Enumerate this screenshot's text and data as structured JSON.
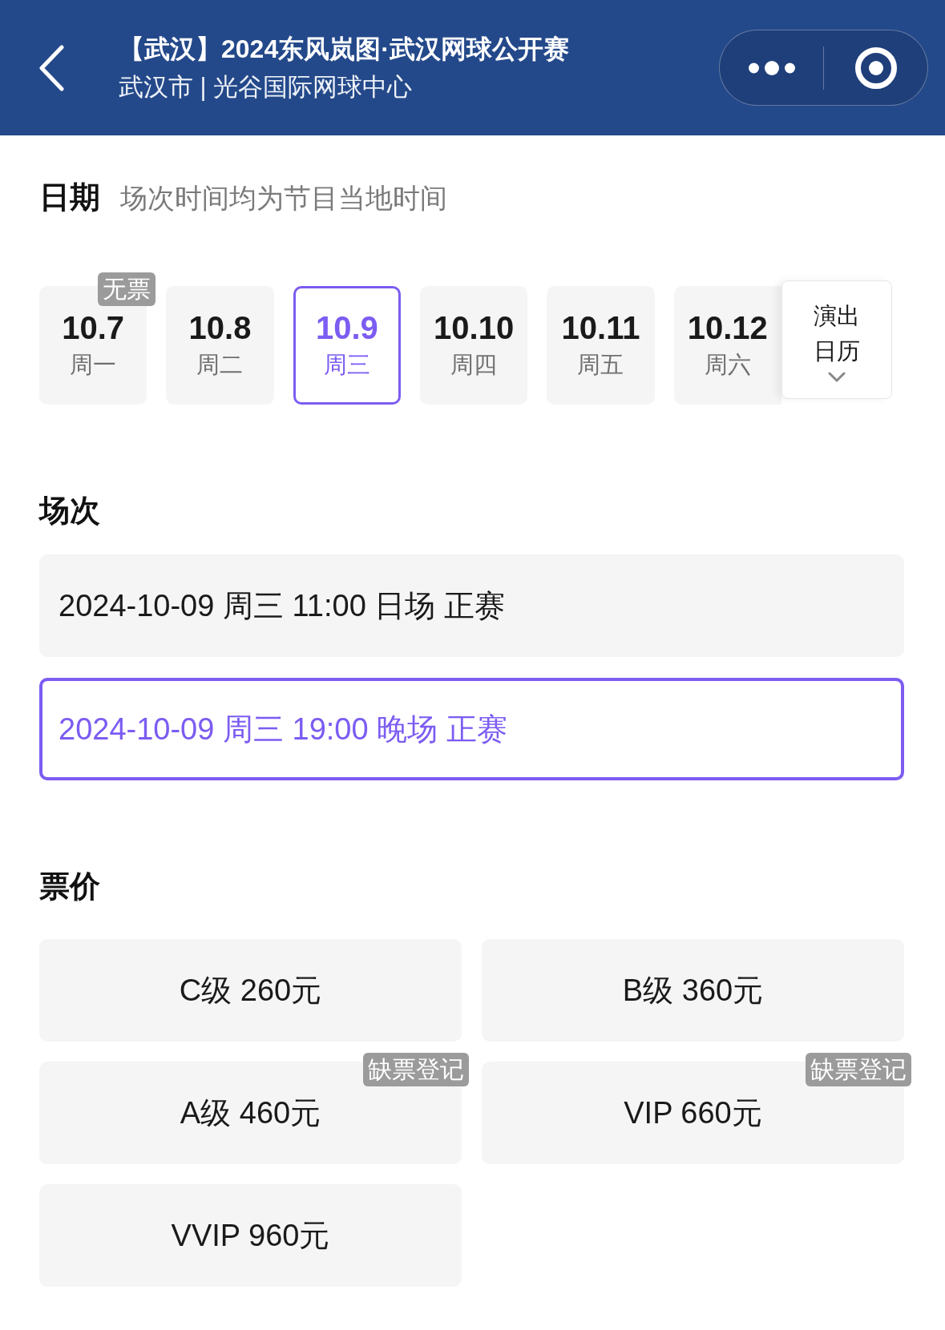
{
  "nav_bar": {
    "title": "【武汉】2024东风岚图·武汉网球公开赛",
    "subtitle": "武汉市 | 光谷国际网球中心"
  },
  "date_section": {
    "heading": "日期",
    "note": "场次时间均为节目当地时间",
    "dates": [
      {
        "date": "10.7",
        "weekday": "周一",
        "selected": false,
        "badge": "无票"
      },
      {
        "date": "10.8",
        "weekday": "周二",
        "selected": false
      },
      {
        "date": "10.9",
        "weekday": "周三",
        "selected": true
      },
      {
        "date": "10.10",
        "weekday": "周四",
        "selected": false
      },
      {
        "date": "10.11",
        "weekday": "周五",
        "selected": false
      },
      {
        "date": "10.12",
        "weekday": "周六",
        "selected": false
      }
    ],
    "calendar_button": {
      "label": "演出日历"
    }
  },
  "session_section": {
    "heading": "场次",
    "sessions": [
      {
        "label": "2024-10-09 周三 11:00 日场 正赛",
        "selected": false
      },
      {
        "label": "2024-10-09 周三 19:00 晚场 正赛",
        "selected": true
      }
    ]
  },
  "price_section": {
    "heading": "票价",
    "prices": [
      {
        "label": "C级 260元",
        "selected": false
      },
      {
        "label": "B级 360元",
        "selected": false
      },
      {
        "label": "A级 460元",
        "selected": false,
        "badge": "缺票登记"
      },
      {
        "label": "VIP 660元",
        "selected": false,
        "badge": "缺票登记"
      },
      {
        "label": "VVIP 960元",
        "selected": false
      }
    ]
  }
}
